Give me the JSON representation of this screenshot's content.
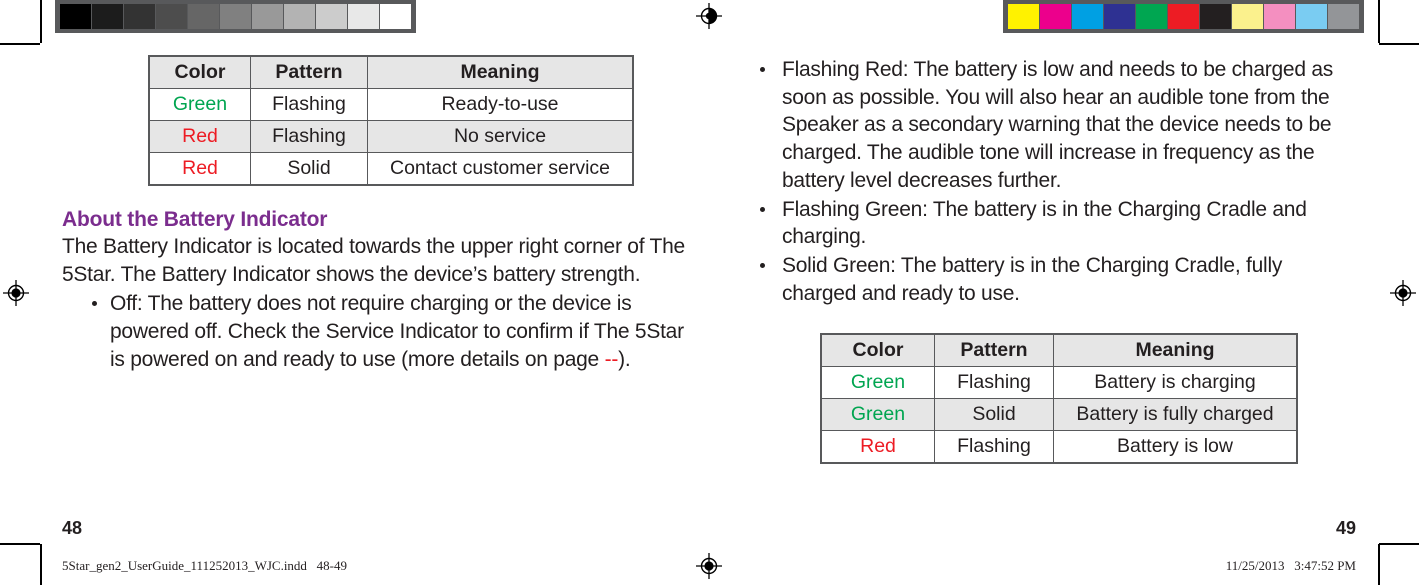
{
  "document": {
    "grayscale_strip": {
      "name": "grayscale-calibration-strip",
      "patches": [
        "#000000",
        "#1c1c1c",
        "#333333",
        "#4d4d4d",
        "#666666",
        "#808080",
        "#999999",
        "#b3b3b3",
        "#cccccc",
        "#e8e8e8",
        "#ffffff"
      ]
    },
    "color_strip": {
      "name": "color-calibration-strip",
      "patches": [
        "#fff200",
        "#ec008c",
        "#00a0e3",
        "#2e3192",
        "#00a651",
        "#ed1c24",
        "#231f20",
        "#fbf18d",
        "#f48fc0",
        "#7accf2",
        "#939598"
      ]
    }
  },
  "left_page": {
    "folio": "48",
    "service_indicator_table": {
      "headers": [
        "Color",
        "Pattern",
        "Meaning"
      ],
      "rows": [
        {
          "color": "Green",
          "color_swatch": "#00a550",
          "pattern": "Flashing",
          "meaning": "Ready-to-use",
          "band": false
        },
        {
          "color": "Red",
          "color_swatch": "#ed1c24",
          "pattern": "Flashing",
          "meaning": "No service",
          "band": true
        },
        {
          "color": "Red",
          "color_swatch": "#ed1c24",
          "pattern": "Solid",
          "meaning": "Contact customer service",
          "band": false
        }
      ]
    },
    "heading": "About the Battery Indicator",
    "heading_color": "#7b2d8e",
    "paragraph": "The Battery Indicator is located towards the upper right corner of The 5Star. The Battery Indicator shows the device’s battery strength.",
    "bullets": [
      {
        "text_before": "Off: The battery does not require charging or the device is powered off. Check the Service Indicator to confirm if The 5Star is powered on and ready to use (more details on page ",
        "cross_reference": "--",
        "cross_reference_color": "#ed1c24",
        "text_after": ")."
      }
    ]
  },
  "right_page": {
    "folio": "49",
    "bullets": [
      {
        "text": "Flashing Red: The battery is low and needs to be charged as soon as possible. You will also hear an audible tone from the Speaker as a secondary warning that the device needs to be charged. The audible tone will increase in frequency as the battery level decreases further."
      },
      {
        "text": "Flashing Green: The battery is in the Charging Cradle and charging."
      },
      {
        "text": "Solid Green: The battery is in the Charging Cradle, fully charged and ready to use."
      }
    ],
    "battery_indicator_table": {
      "headers": [
        "Color",
        "Pattern",
        "Meaning"
      ],
      "rows": [
        {
          "color": "Green",
          "color_swatch": "#00a550",
          "pattern": "Flashing",
          "meaning": "Battery is charging",
          "band": false
        },
        {
          "color": "Green",
          "color_swatch": "#00a550",
          "pattern": "Solid",
          "meaning": "Battery is fully charged",
          "band": true
        },
        {
          "color": "Red",
          "color_swatch": "#ed1c24",
          "pattern": "Flashing",
          "meaning": "Battery is low",
          "band": false
        }
      ]
    }
  },
  "imprint": {
    "filename": "5Star_gen2_UserGuide_111252013_WJC.indd   48-49",
    "timestamp": "11/25/2013   3:47:52 PM"
  }
}
